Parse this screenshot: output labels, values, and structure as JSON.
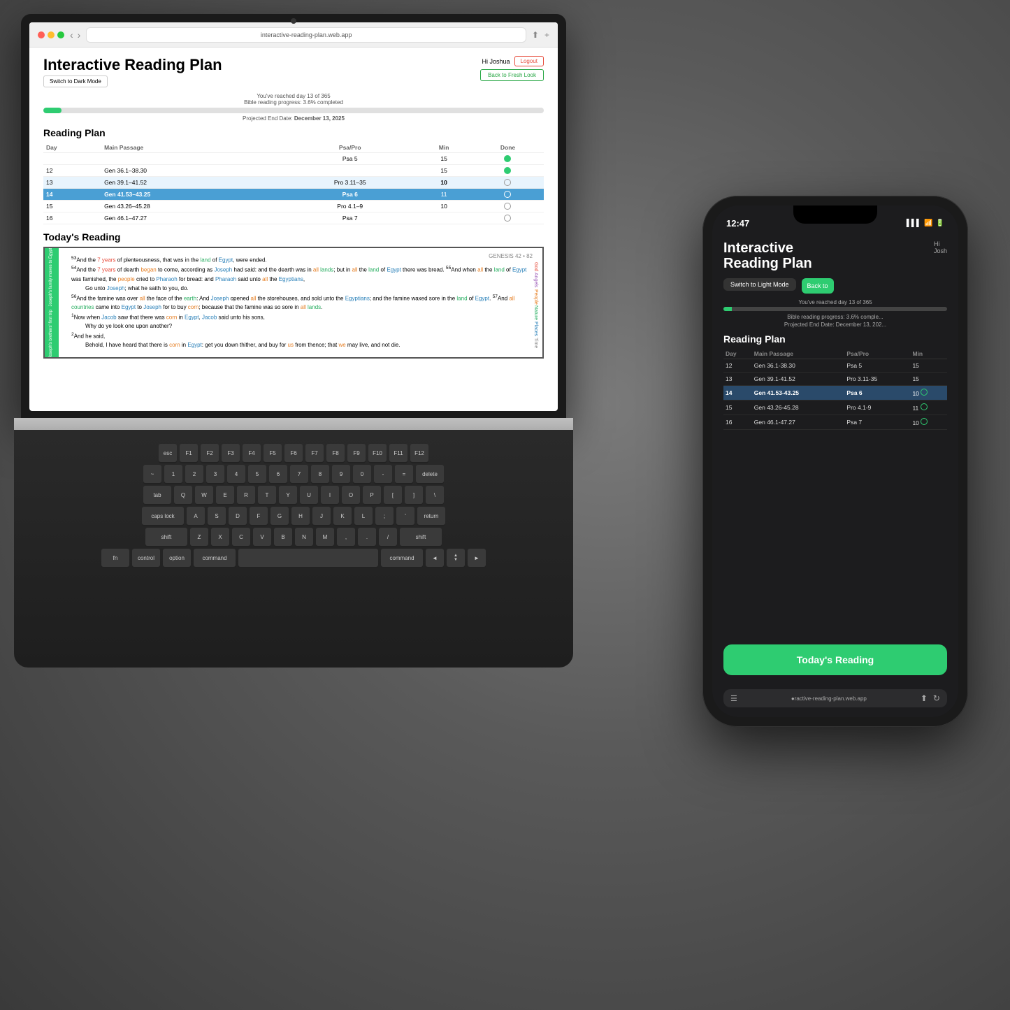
{
  "background": {
    "color": "#5a5a5a"
  },
  "browser": {
    "url": "interactive-reading-plan.web.app",
    "dots": [
      "red",
      "yellow",
      "green"
    ]
  },
  "app": {
    "title": "Interactive Reading Plan",
    "user": {
      "greeting": "Hi Joshua",
      "logout_label": "Logout"
    },
    "back_button": "Back to Fresh Look",
    "dark_mode_button": "Switch to Dark Mode",
    "progress": {
      "text": "You've reached day 13 of 365",
      "sub_text": "Bible reading progress: 3.6% completed",
      "percent": 3.6,
      "projected_label": "Projected End Date:",
      "projected_date": "December 13, 2025"
    },
    "reading_plan": {
      "title": "Reading Plan",
      "columns": [
        "Day",
        "Main Passage",
        "Psa/Pro",
        "Min",
        "Done"
      ],
      "rows": [
        {
          "day": "",
          "main": "",
          "psa_pro": "Psa/Pro",
          "min": "Min",
          "done": "Done",
          "header2": true
        },
        {
          "day": "",
          "main": "",
          "psa_pro": "Psa 5",
          "min": "15",
          "done": "green_dot",
          "special": "header_row"
        },
        {
          "day": "12",
          "main": "Gen 36.1-38.30",
          "psa_pro": "",
          "min": "15",
          "done": "green_dot"
        },
        {
          "day": "13",
          "main": "Gen 39.1-41.52",
          "psa_pro": "Pro 3.11-35",
          "min": "10",
          "done": "circle"
        },
        {
          "day": "14",
          "main": "Gen 41.53-43.25",
          "psa_pro": "Psa 6",
          "min": "11",
          "done": "circle",
          "current": true
        },
        {
          "day": "15",
          "main": "Gen 43.26-45.28",
          "psa_pro": "Pro 4.1-9",
          "min": "10",
          "done": "circle"
        },
        {
          "day": "16",
          "main": "Gen 46.1-47.27",
          "psa_pro": "Psa 7",
          "min": "",
          "done": "circle"
        }
      ]
    },
    "todays_reading": {
      "title": "Today's Reading",
      "chapter_label": "GENESIS 42",
      "chapter_number": "82",
      "text_paragraphs": [
        "53And the 7 years of plenteousness, that was in the land of Egypt, were ended.",
        "54And the 7 years of dearth began to come, according as Joseph had said: and the dearth was in all lands; but in all the land of Egypt there was bread. 55And when all the land of Egypt was famished, the people cried to Pharaoh for bread: and Pharaoh said unto all the Egyptians,",
        "Go unto Joseph; what he saith to you, do.",
        "56And the famine was over all the face of the earth: And Joseph opened all the storehouses, and sold unto the Egyptians; and the famine waxed sore in the land of Egypt. 57And all countries came into Egypt to Joseph for to buy corn; because that the famine was so sore in all lands.",
        "1Now when Jacob saw that there was corn in Egypt, Jacob said unto his sons,",
        "Why do ye look one upon another?",
        "2And he said,",
        "Behold, I have heard that there is corn in Egypt: get you down thither, and buy for us from thence; that we may live, and not die."
      ],
      "side_labels": [
        "God",
        "Angels",
        "People",
        "Nature",
        "Places",
        "Time"
      ],
      "left_strip_labels": [
        "Joseph's family moves to Egypt!",
        "Joseph's brothers' first trip"
      ]
    }
  },
  "phone": {
    "status_bar": {
      "time": "12:47",
      "icons": "●●●"
    },
    "app": {
      "title": "Interactive\nReading Plan",
      "user_greeting": "Hi\nJosh",
      "switch_mode_btn": "Switch to Light Mode",
      "back_btn": "Back to",
      "progress_text": "You've reached day 13 of 365",
      "progress_sub": "Bible reading progress: 3.6% comple...",
      "projected": "Projected End Date: December 13, 202...",
      "reading_plan_title": "Reading Plan",
      "table_cols": [
        "Day",
        "Main Passage",
        "Psa/Pro",
        "Min"
      ],
      "table_rows": [
        {
          "day": "12",
          "main": "Gen 36.1-38.30",
          "psa_pro": "Psa 5",
          "min": "15"
        },
        {
          "day": "13",
          "main": "Gen 39.1-41.52",
          "psa_pro": "Pro 3.11-35",
          "min": "15"
        },
        {
          "day": "14",
          "main": "Gen 41.53-43.25",
          "psa_pro": "Psa 6",
          "min": "10",
          "current": true
        },
        {
          "day": "15",
          "main": "Gen 43.26-45.28",
          "psa_pro": "Pro 4.1-9",
          "min": "11"
        },
        {
          "day": "16",
          "main": "Gen 46.1-47.27",
          "psa_pro": "Psa 7",
          "min": "10"
        }
      ],
      "todays_reading_btn": "Today's Reading",
      "browser_url": "●ractive-reading-plan.web.app"
    }
  }
}
